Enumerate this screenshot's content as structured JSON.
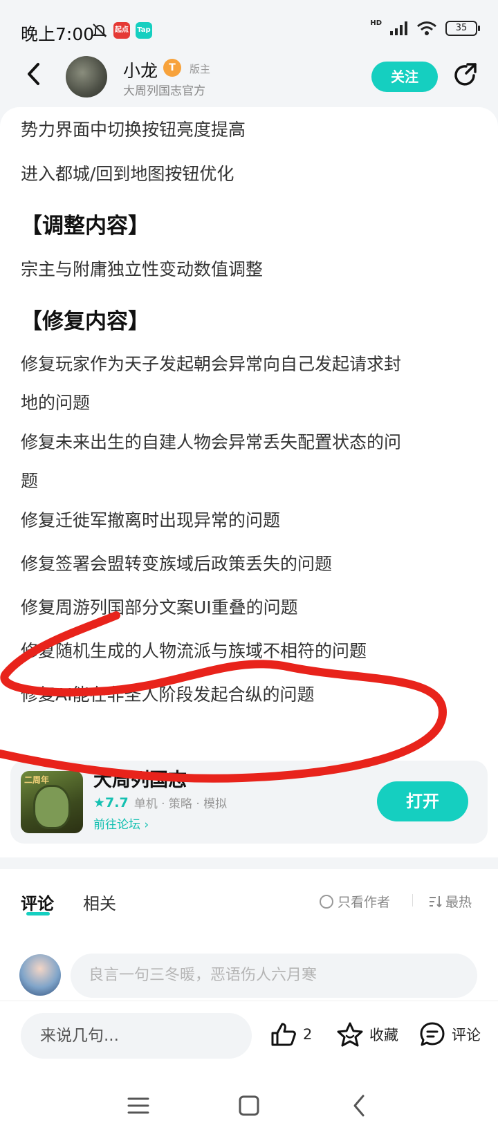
{
  "status_bar": {
    "time": "晚上7:00",
    "app_badge_1": "起点",
    "app_badge_2": "Tap",
    "network": "HD",
    "battery": "35"
  },
  "header": {
    "author_name": "小龙",
    "author_level": "T",
    "author_role": "版主",
    "author_sub": "大周列国志官方",
    "follow_label": "关注"
  },
  "content": {
    "paragraphs": [
      "势力界面中切换按钮亮度提高",
      "进入都城/回到地图按钮优化"
    ],
    "section_adjust": "【调整内容】",
    "adjust_items": [
      "宗主与附庸独立性变动数值调整"
    ],
    "section_fix": "【修复内容】",
    "fix_items": [
      "修复玩家作为天子发起朝会异常向自己发起请求封",
      "地的问题",
      "修复未来出生的自建人物会异常丢失配置状态的问",
      "题",
      "修复迁徙军撤离时出现异常的问题",
      "修复签署会盟转变族域后政策丢失的问题",
      "修复周游列国部分文案UI重叠的问题",
      "修复随机生成的人物流派与族域不相符的问题",
      "修复AI能在非圣人阶段发起合纵的问题"
    ]
  },
  "game_card": {
    "icon_label": "二周年",
    "name": "大周列国志",
    "score": "★7.7",
    "tags": "单机 · 策略 · 模拟",
    "link": "前往论坛 ›",
    "open_label": "打开"
  },
  "comments": {
    "tab_comments": "评论",
    "tab_related": "相关",
    "filter_author": "只看作者",
    "sort": "最热",
    "input_placeholder": "良言一句三冬暖，恶语伤人六月寒"
  },
  "bottom_bar": {
    "input_placeholder": "来说几句...",
    "like_count": "2",
    "collect_label": "收藏",
    "comment_label": "评论"
  },
  "colors": {
    "accent": "#15cfc0",
    "scribble": "#e8231b"
  }
}
